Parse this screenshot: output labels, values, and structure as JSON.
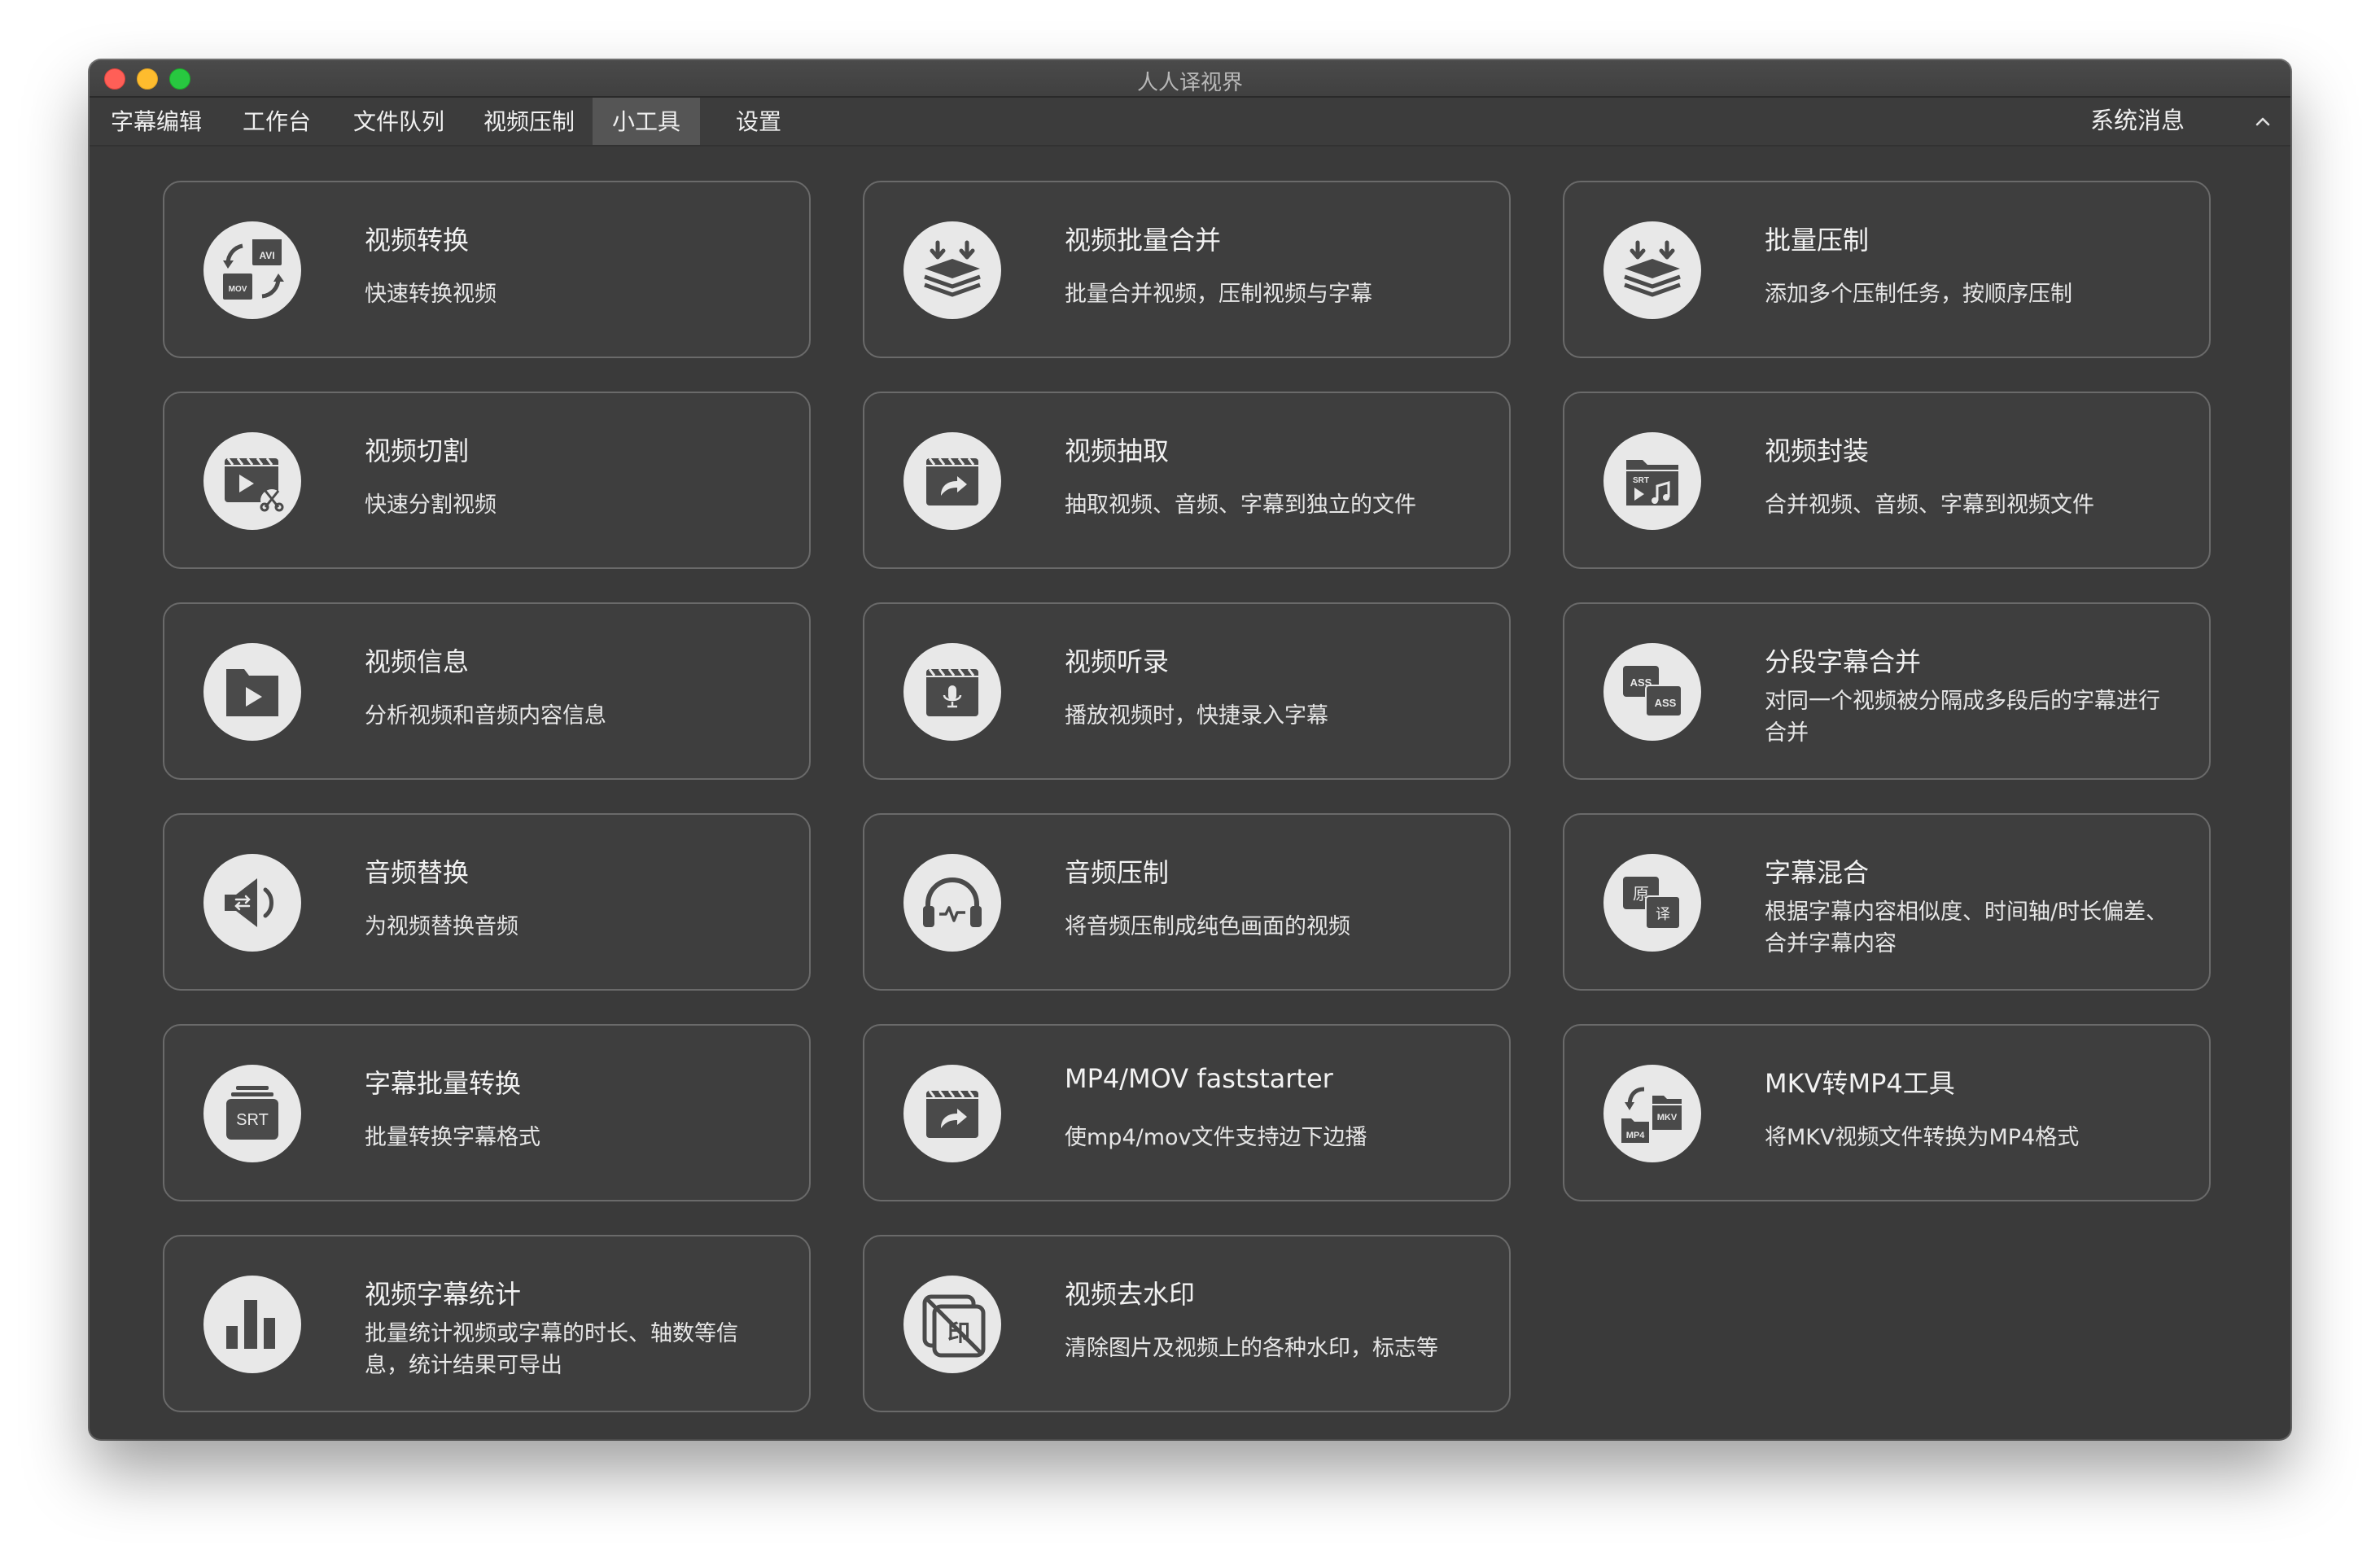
{
  "window": {
    "title": "人人译视界"
  },
  "menu": {
    "items": [
      {
        "label": "字幕编辑"
      },
      {
        "label": "工作台"
      },
      {
        "label": "文件队列"
      },
      {
        "label": "视频压制"
      },
      {
        "label": "小工具"
      },
      {
        "label": "设置"
      }
    ],
    "active": "小工具",
    "system_messages": "系统消息"
  },
  "tools": [
    {
      "title": "视频转换",
      "desc": "快速转换视频",
      "icon": "video-convert-icon"
    },
    {
      "title": "视频批量合并",
      "desc": "批量合并视频，压制视频与字幕",
      "icon": "layers-download-icon"
    },
    {
      "title": "批量压制",
      "desc": "添加多个压制任务，按顺序压制",
      "icon": "layers-download-icon"
    },
    {
      "title": "视频切割",
      "desc": "快速分割视频",
      "icon": "video-scissors-icon"
    },
    {
      "title": "视频抽取",
      "desc": "抽取视频、音频、字幕到独立的文件",
      "icon": "video-share-icon"
    },
    {
      "title": "视频封装",
      "desc": "合并视频、音频、字幕到视频文件",
      "icon": "folder-srt-music-icon"
    },
    {
      "title": "视频信息",
      "desc": "分析视频和音频内容信息",
      "icon": "folder-play-icon"
    },
    {
      "title": "视频听录",
      "desc": "播放视频时，快捷录入字幕",
      "icon": "video-mic-icon"
    },
    {
      "title": "分段字幕合并",
      "desc": "对同一个视频被分隔成多段后的字幕进行合并",
      "icon": "ass-merge-icon"
    },
    {
      "title": "音频替换",
      "desc": "为视频替换音频",
      "icon": "speaker-swap-icon"
    },
    {
      "title": "音频压制",
      "desc": "将音频压制成纯色画面的视频",
      "icon": "headphones-icon"
    },
    {
      "title": "字幕混合",
      "desc": "根据字幕内容相似度、时间轴/时长偏差、合并字幕内容",
      "icon": "subtitle-mix-icon"
    },
    {
      "title": "字幕批量转换",
      "desc": "批量转换字幕格式",
      "icon": "srt-stack-icon"
    },
    {
      "title": "MP4/MOV faststarter",
      "desc": "使mp4/mov文件支持边下边播",
      "icon": "video-share-icon"
    },
    {
      "title": "MKV转MP4工具",
      "desc": "将MKV视频文件转换为MP4格式",
      "icon": "mkv-mp4-icon"
    },
    {
      "title": "视频字幕统计",
      "desc": "批量统计视频或字幕的时长、轴数等信息，统计结果可导出",
      "icon": "bar-chart-icon"
    },
    {
      "title": "视频去水印",
      "desc": "清除图片及视频上的各种水印，标志等",
      "icon": "watermark-remove-icon"
    }
  ],
  "icon_text": {
    "avi": "AVI",
    "mov": "MOV",
    "srt": "SRT",
    "ass": "ASS",
    "yuan": "原",
    "yi": "译",
    "mkv": "MKV",
    "mp4": "MP4",
    "yin": "印"
  },
  "colors": {
    "window_bg": "#3a3a3a",
    "card_border": "#6a6a6a",
    "icon_bg": "#e8e8e8",
    "icon_fg": "#4a4a4a",
    "text": "#f2f2f2"
  }
}
